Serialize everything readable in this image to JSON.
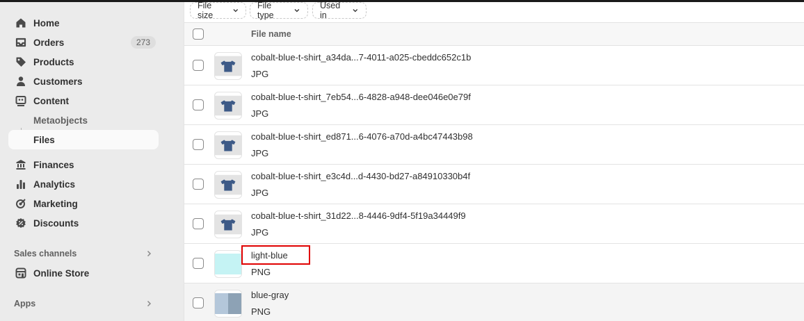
{
  "sidebar": {
    "items": [
      {
        "label": "Home",
        "icon": "home-icon"
      },
      {
        "label": "Orders",
        "icon": "inbox-icon",
        "badge": "273"
      },
      {
        "label": "Products",
        "icon": "tag-icon"
      },
      {
        "label": "Customers",
        "icon": "person-icon"
      },
      {
        "label": "Content",
        "icon": "content-icon"
      }
    ],
    "sub_items": [
      {
        "label": "Metaobjects"
      },
      {
        "label": "Files",
        "active": true
      }
    ],
    "items2": [
      {
        "label": "Finances",
        "icon": "bank-icon"
      },
      {
        "label": "Analytics",
        "icon": "chart-bar-icon"
      },
      {
        "label": "Marketing",
        "icon": "target-icon"
      },
      {
        "label": "Discounts",
        "icon": "discount-icon"
      }
    ],
    "sales_channels": {
      "label": "Sales channels"
    },
    "online_store": {
      "label": "Online Store",
      "icon": "store-icon"
    },
    "apps": {
      "label": "Apps"
    }
  },
  "filters": [
    {
      "label": "File size"
    },
    {
      "label": "File type"
    },
    {
      "label": "Used in"
    }
  ],
  "table": {
    "header": {
      "file_name": "File name"
    },
    "rows": [
      {
        "name": "cobalt-blue-t-shirt_a34da...7-4011-a025-cbeddc652c1b",
        "type": "JPG",
        "thumb": "tshirt"
      },
      {
        "name": "cobalt-blue-t-shirt_7eb54...6-4828-a948-dee046e0e79f",
        "type": "JPG",
        "thumb": "tshirt"
      },
      {
        "name": "cobalt-blue-t-shirt_ed871...6-4076-a70d-a4bc47443b98",
        "type": "JPG",
        "thumb": "tshirt"
      },
      {
        "name": "cobalt-blue-t-shirt_e3c4d...d-4430-bd27-a84910330b4f",
        "type": "JPG",
        "thumb": "tshirt"
      },
      {
        "name": "cobalt-blue-t-shirt_31d22...8-4446-9df4-5f19a34449f9",
        "type": "JPG",
        "thumb": "tshirt"
      },
      {
        "name": "light-blue",
        "type": "PNG",
        "thumb": "swatch-light-blue",
        "highlighted": true
      },
      {
        "name": "blue-gray",
        "type": "PNG",
        "thumb": "swatch-blue-gray"
      }
    ]
  },
  "colors": {
    "highlight_box": "#e00000",
    "light_blue_swatch": "#c5f3f4",
    "blue_gray_left": "#b4c7da",
    "blue_gray_right": "#8da2b5",
    "tshirt": "#3d5a87"
  }
}
